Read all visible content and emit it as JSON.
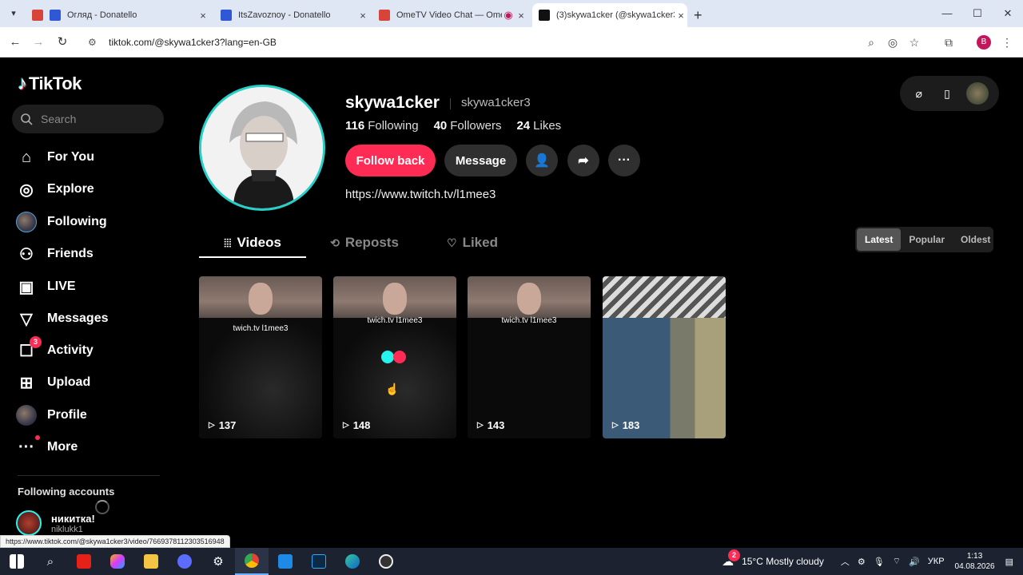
{
  "browser": {
    "tabs": [
      {
        "title": "Огляд - Donatello",
        "fav_color": "#2f57d6"
      },
      {
        "title": "ItsZavoznoy - Donatello",
        "fav_color": "#2f57d6"
      },
      {
        "title": "OmeTV Video Chat — Ome",
        "fav_color": "#d9443a"
      },
      {
        "title": "(3)skywa1cker (@skywa1cker3)",
        "fav_color": "#111111"
      }
    ],
    "url": "tiktok.com/@skywa1cker3?lang=en-GB",
    "profile_letter": "B"
  },
  "sidebar": {
    "logo": "TikTok",
    "search_placeholder": "Search",
    "items": [
      {
        "label": "For You",
        "icon": "home-icon"
      },
      {
        "label": "Explore",
        "icon": "compass-icon"
      },
      {
        "label": "Following",
        "icon": "avatar-icon"
      },
      {
        "label": "Friends",
        "icon": "friends-icon"
      },
      {
        "label": "LIVE",
        "icon": "live-icon"
      },
      {
        "label": "Messages",
        "icon": "paper-plane-icon"
      },
      {
        "label": "Activity",
        "icon": "inbox-icon",
        "badge": "3"
      },
      {
        "label": "Upload",
        "icon": "plus-square-icon"
      },
      {
        "label": "Profile",
        "icon": "profile-avatar-icon"
      },
      {
        "label": "More",
        "icon": "more-icon"
      }
    ],
    "following_title": "Following accounts",
    "following_account": {
      "name": "никитка!",
      "handle": "niklukk1"
    }
  },
  "profile": {
    "name": "skywa1cker",
    "username": "skywa1cker3",
    "following_count": "116",
    "following_label": "Following",
    "followers_count": "40",
    "followers_label": "Followers",
    "likes_count": "24",
    "likes_label": "Likes",
    "follow_back": "Follow back",
    "message": "Message",
    "link": "https://www.twitch.tv/l1mee3"
  },
  "tabs": [
    "Videos",
    "Reposts",
    "Liked"
  ],
  "sort": [
    "Latest",
    "Popular",
    "Oldest"
  ],
  "videos": [
    {
      "caption": "twich.tv l1mee3",
      "views": "137"
    },
    {
      "caption": "twich.tv l1mee3",
      "views": "148"
    },
    {
      "caption": "twich.tv l1mee3",
      "views": "143"
    },
    {
      "caption": "",
      "views": "183"
    }
  ],
  "status_url": "https://www.tiktok.com/@skywa1cker3/video/7669378112303516948",
  "taskbar": {
    "weather_badge": "2",
    "weather": "15°C  Mostly cloudy",
    "lang": "УКР",
    "time": "1:13",
    "date": "04.08.2026"
  }
}
